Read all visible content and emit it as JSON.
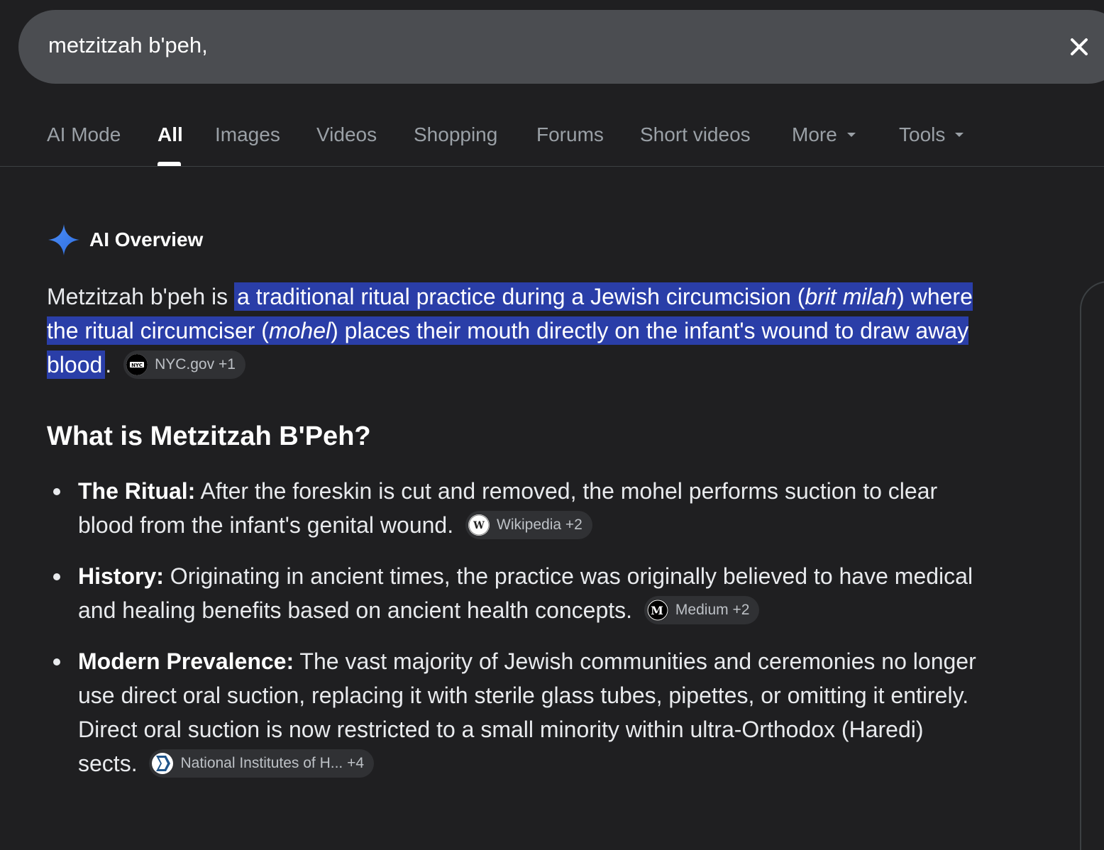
{
  "search": {
    "query": "metzitzah b'peh,",
    "clear_icon": "close-icon"
  },
  "tabs": [
    {
      "label": "AI Mode",
      "active": false
    },
    {
      "label": "All",
      "active": true
    },
    {
      "label": "Images",
      "active": false
    },
    {
      "label": "Videos",
      "active": false
    },
    {
      "label": "Shopping",
      "active": false
    },
    {
      "label": "Forums",
      "active": false
    },
    {
      "label": "Short videos",
      "active": false
    },
    {
      "label": "More",
      "active": false
    },
    {
      "label": "Tools",
      "active": false
    }
  ],
  "ai_overview": {
    "title": "AI Overview",
    "icon": "sparkle-icon",
    "intro_prefix": "Metzitzah b'peh is ",
    "intro_hl_1": "a traditional ritual practice during a Jewish circumcision (",
    "intro_hl_italic_1": "brit milah",
    "intro_hl_2": ") where the ritual circumciser (",
    "intro_hl_italic_2": "mohel",
    "intro_hl_3": ") places their mouth directly on the infant's wound to draw away blood",
    "intro_suffix": ".",
    "intro_citation": "NYC.gov +1",
    "heading": "What is Metzitzah B'Peh?",
    "bullets": [
      {
        "label": "The Ritual:",
        "text": " After the foreskin is cut and removed, the mohel performs suction to clear blood from the infant's genital wound.",
        "citation": "Wikipedia +2"
      },
      {
        "label": "History:",
        "text": " Originating in ancient times, the practice was originally believed to have medical and healing benefits based on ancient health concepts.",
        "citation": "Medium +2"
      },
      {
        "label": "Modern Prevalence:",
        "text": " The vast majority of Jewish communities and ceremonies no longer use direct oral suction, replacing it with sterile glass tubes, pipettes, or omitting it entirely. Direct oral suction is now restricted to a small minority within ultra-Orthodox (Haredi) sects.",
        "citation": "National Institutes of H... +4"
      }
    ]
  },
  "colors": {
    "background": "#1f1f21",
    "search_bg": "#4b4d51",
    "highlight": "#2a3ea8",
    "sparkle": "#4c8df6"
  }
}
